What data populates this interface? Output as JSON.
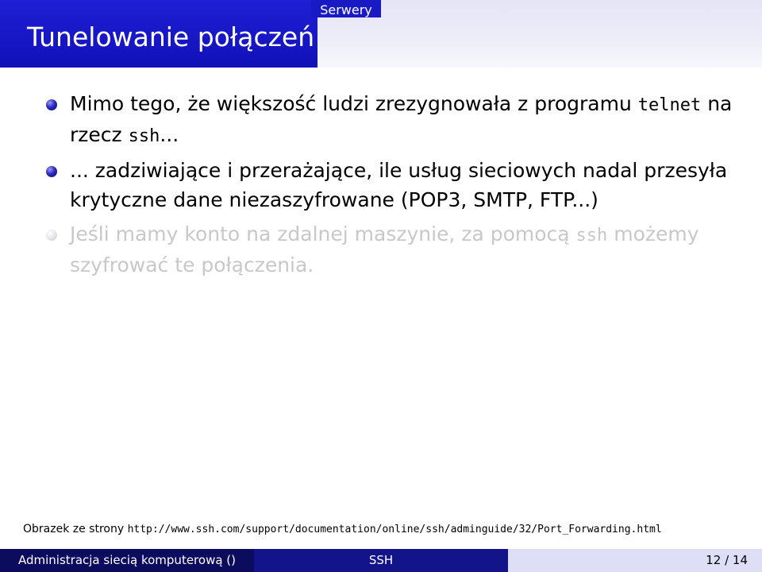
{
  "header": {
    "section": "Serwery",
    "frame_title": "Tunelowanie połączeń",
    "colors": {
      "title_bar": "#1a1ac4",
      "header_right": "#e8e8f7"
    }
  },
  "bullets": [
    {
      "state": "active",
      "text_before": "Mimo tego, że większość ludzi zrezygnowała z programu ",
      "code1": "telnet",
      "text_middle": " na rzecz ",
      "code2": "ssh",
      "text_after": "..."
    },
    {
      "state": "active",
      "text": "... zadziwiające i przerażające, ile usług sieciowych nadal przesyła krytyczne dane niezaszyfrowane (POP3, SMTP, FTP...)"
    },
    {
      "state": "dimmed",
      "text_before": "Jeśli mamy konto na zdalnej maszynie, za pomocą ",
      "code": "ssh",
      "text_after": " możemy szyfrować te połączenia."
    }
  ],
  "credit": {
    "label": "Obrazek ze strony ",
    "url": "http://www.ssh.com/support/documentation/online/ssh/adminguide/32/Port_Forwarding.html"
  },
  "footer": {
    "author": "Administracja siecią komputerową ()",
    "short_title": "SSH",
    "page": "12 / 14",
    "colors": {
      "left": "#0c0c5e",
      "middle": "#13138a",
      "right": "#dedef6"
    }
  }
}
